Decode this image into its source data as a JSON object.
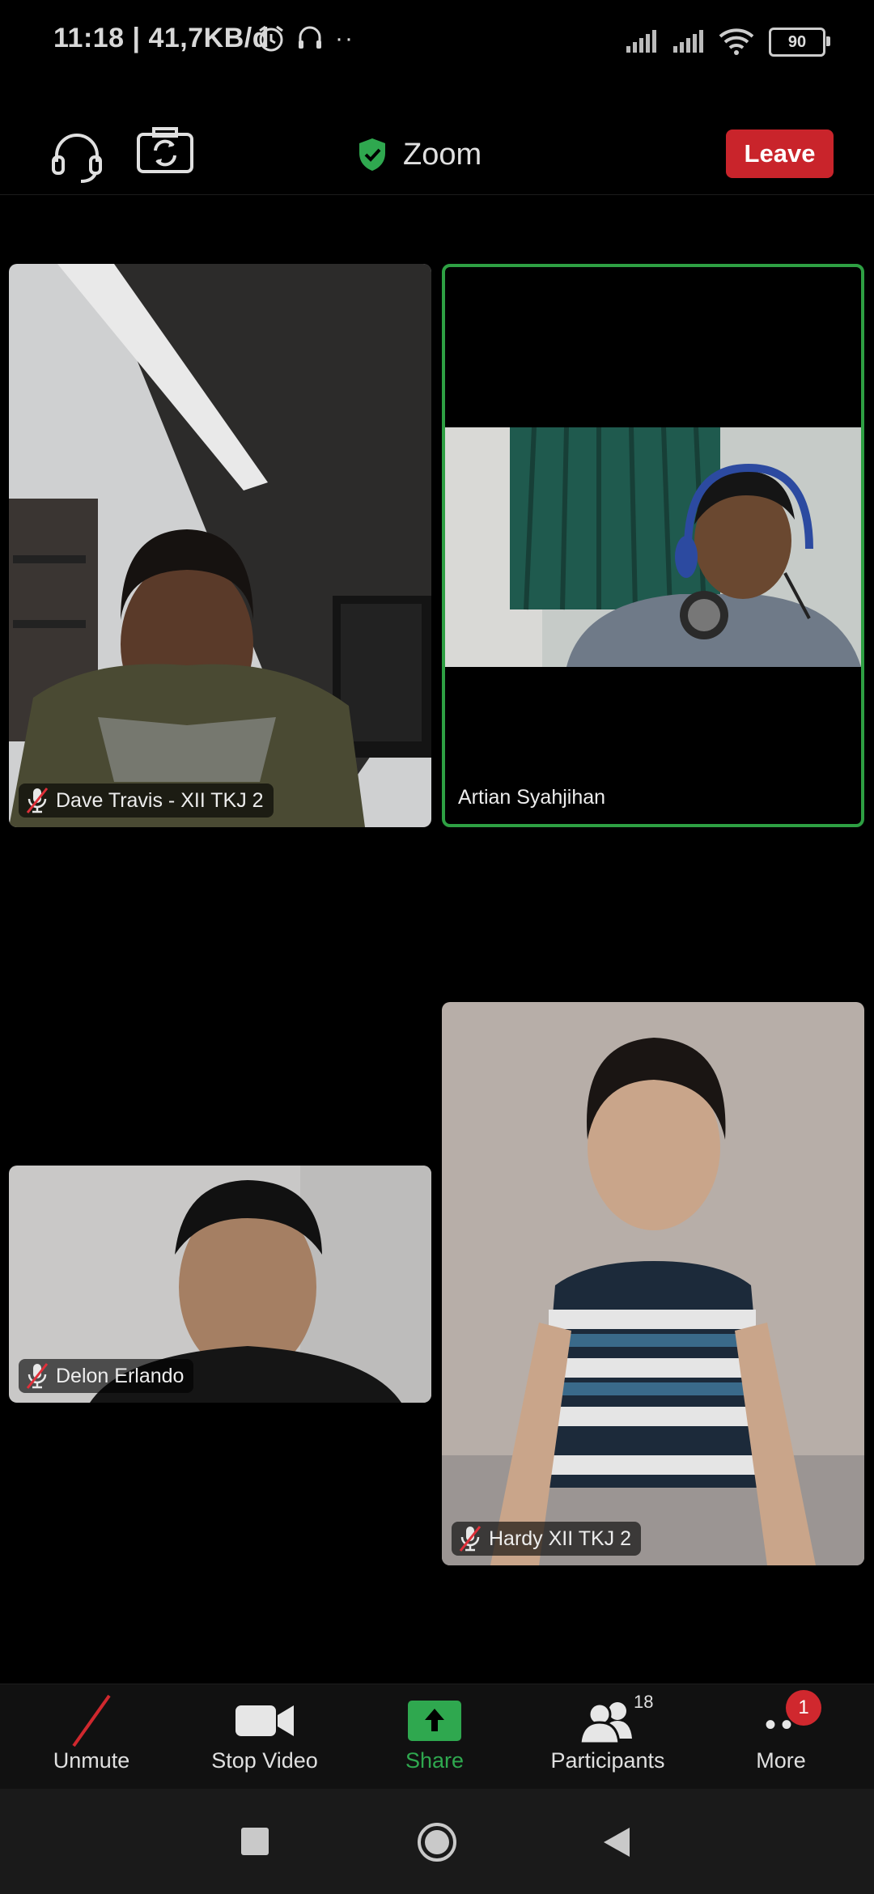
{
  "status_bar": {
    "time_speed": "11:18 | 41,7KB/d",
    "battery": "90"
  },
  "top_bar": {
    "title": "Zoom",
    "leave_label": "Leave"
  },
  "tiles": [
    {
      "name": "Dave Travis - XII TKJ 2",
      "muted": true
    },
    {
      "name": "Artian Syahjihan",
      "muted": false,
      "active_speaker": true
    },
    {
      "name": "Delon Erlando",
      "muted": true
    },
    {
      "name": "Hardy XII TKJ 2",
      "muted": true
    }
  ],
  "toolbar": {
    "unmute": "Unmute",
    "stop_video": "Stop Video",
    "share": "Share",
    "participants": "Participants",
    "participants_count": "18",
    "more": "More",
    "more_badge": "1"
  },
  "colors": {
    "leave": "#c9242b",
    "active_border": "#2ea043",
    "share_green": "#2fa84f",
    "badge_red": "#d0282e"
  },
  "icons": {
    "top_left": [
      "headset-icon",
      "switch-camera-icon",
      "shield-check-icon"
    ],
    "toolbar": [
      "mic-off-icon",
      "video-camera-icon",
      "share-arrow-icon",
      "participants-icon",
      "more-dots-icon"
    ],
    "nav": [
      "recent-apps-icon",
      "home-icon",
      "back-icon"
    ]
  }
}
